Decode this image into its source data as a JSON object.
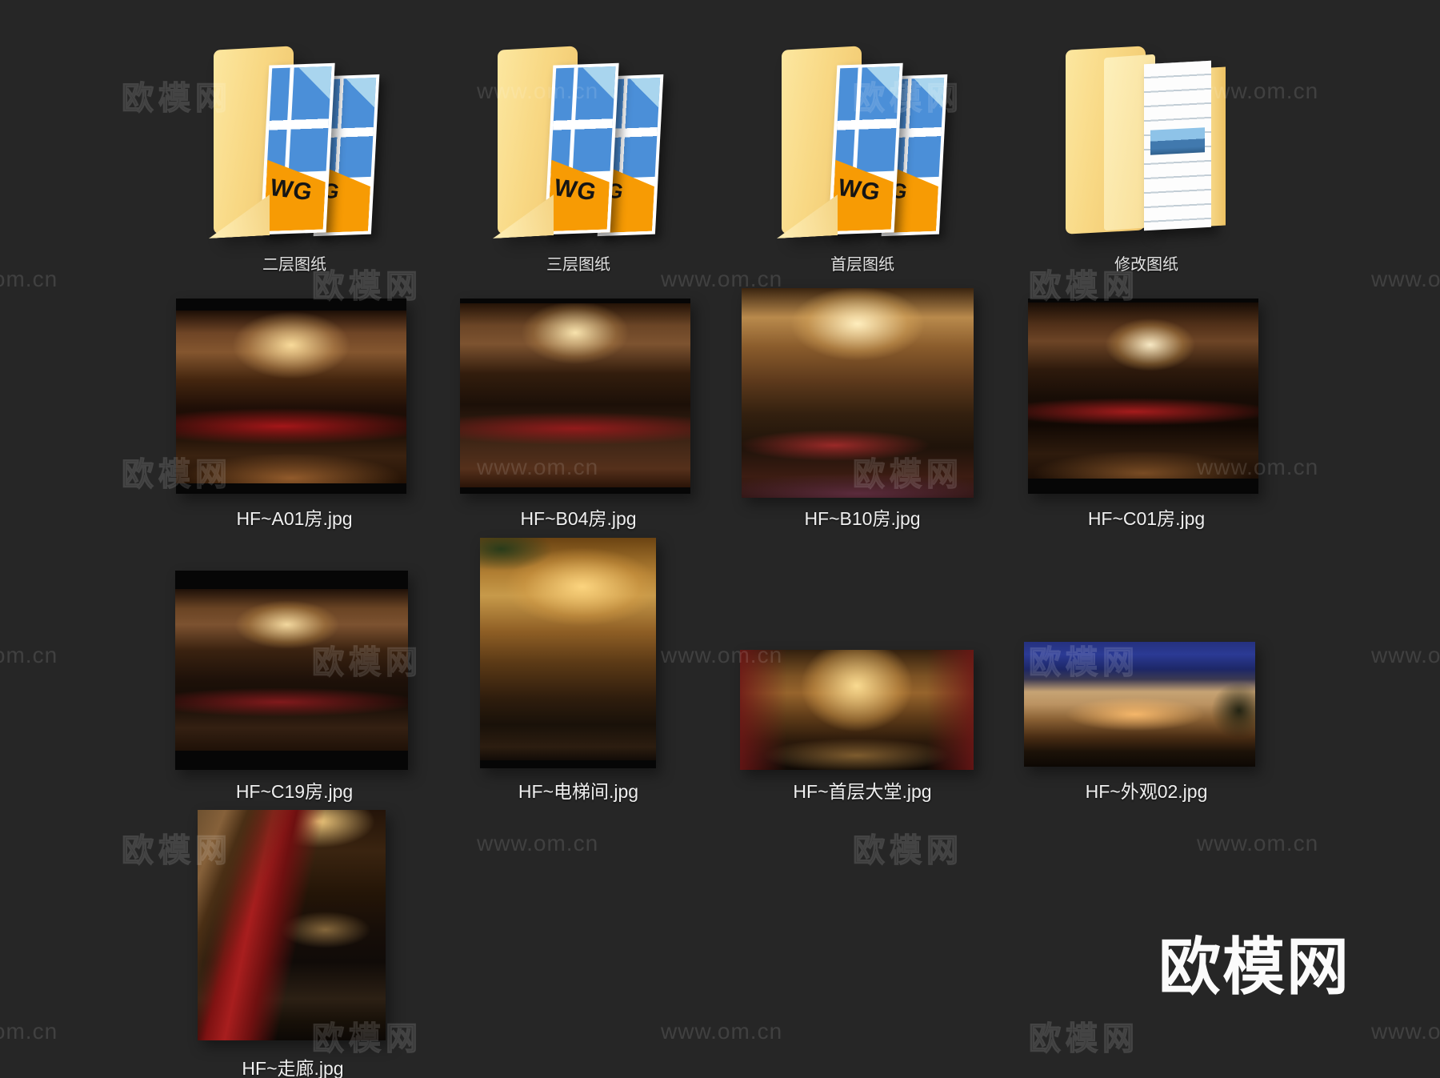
{
  "window": {
    "background": "#262626"
  },
  "branding": {
    "logo_text": "欧模网",
    "watermark_brand": "欧模网",
    "watermark_url": "www.om.cn"
  },
  "dwg_badge": {
    "front": "WG",
    "back": "G"
  },
  "folders": [
    {
      "label": "二层图纸"
    },
    {
      "label": "三层图纸"
    },
    {
      "label": "首层图纸"
    },
    {
      "label": "修改图纸"
    }
  ],
  "files": [
    {
      "label": "HF~A01房.jpg"
    },
    {
      "label": "HF~B04房.jpg"
    },
    {
      "label": "HF~B10房.jpg"
    },
    {
      "label": "HF~C01房.jpg"
    },
    {
      "label": "HF~C19房.jpg"
    },
    {
      "label": "HF~电梯间.jpg"
    },
    {
      "label": "HF~首层大堂.jpg"
    },
    {
      "label": "HF~外观02.jpg"
    },
    {
      "label": "HF~走廊.jpg"
    }
  ]
}
